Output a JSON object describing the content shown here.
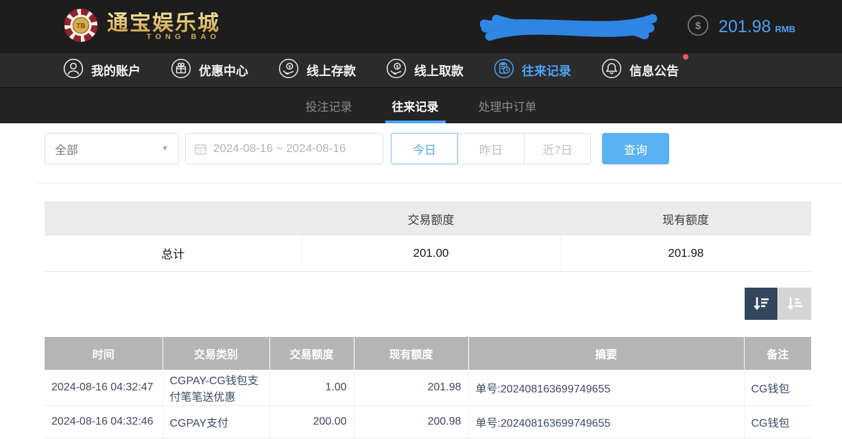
{
  "colors": {
    "accent_blue": "#5bb2f0",
    "balance_blue": "#4da0f0",
    "active_nav_blue": "#4da3f5",
    "notification_red": "#f4536e",
    "sort_active_bg": "#33475c",
    "table_header_gray": "#b5b5b5"
  },
  "header": {
    "logo": {
      "chip_text": "TB",
      "title": "通宝娱乐城",
      "subtitle": "TONG BAO"
    },
    "balance": {
      "amount": "201.98",
      "currency": "RMB"
    }
  },
  "nav": {
    "items": [
      {
        "label": "我的账户",
        "icon": "user-circle-icon"
      },
      {
        "label": "优惠中心",
        "icon": "gift-icon"
      },
      {
        "label": "线上存款",
        "icon": "deposit-hand-coin-icon"
      },
      {
        "label": "线上取款",
        "icon": "withdraw-hand-coin-icon"
      },
      {
        "label": "往来记录",
        "icon": "records-clipboard-icon",
        "active": true
      },
      {
        "label": "信息公告",
        "icon": "bell-icon",
        "has_notification": true
      }
    ]
  },
  "tabs": [
    {
      "label": "投注记录"
    },
    {
      "label": "往来记录",
      "active": true
    },
    {
      "label": "处理中订单"
    }
  ],
  "filters": {
    "type_select": {
      "value": "全部"
    },
    "date_range": "2024-08-16 ~ 2024-08-16",
    "quick_ranges": [
      {
        "label": "今日",
        "active": true
      },
      {
        "label": "昨日"
      },
      {
        "label": "近7日"
      }
    ],
    "query_button": "查询"
  },
  "summary": {
    "headers": {
      "amount": "交易额度",
      "balance": "现有额度"
    },
    "total": {
      "label": "总计",
      "amount": "201.00",
      "balance": "201.98"
    }
  },
  "table": {
    "headers": [
      "时间",
      "交易类别",
      "交易额度",
      "现有额度",
      "摘要",
      "备注"
    ],
    "rows": [
      {
        "time": "2024-08-16 04:32:47",
        "type": "CGPAY-CG钱包支付笔笔送优惠",
        "amount": "1.00",
        "balance": "201.98",
        "summary": "单号:202408163699749655",
        "remark": "CG钱包"
      },
      {
        "time": "2024-08-16 04:32:46",
        "type": "CGPAY支付",
        "amount": "200.00",
        "balance": "200.98",
        "summary": "单号:202408163699749655",
        "remark": "CG钱包"
      }
    ]
  }
}
